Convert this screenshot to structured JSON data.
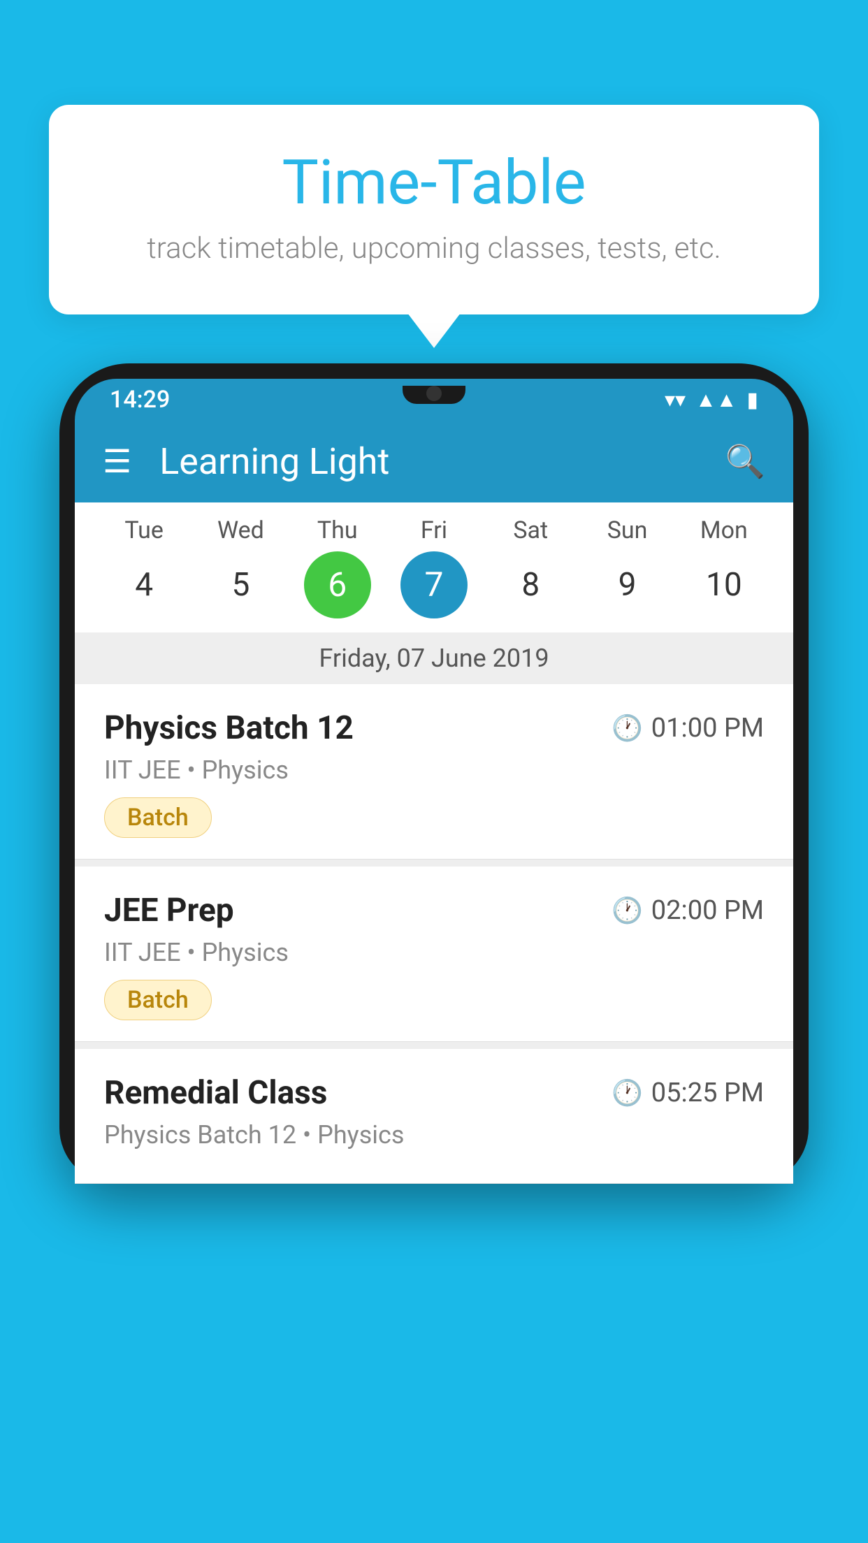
{
  "page": {
    "background_color": "#1ab9e8"
  },
  "tooltip": {
    "title": "Time-Table",
    "subtitle": "track timetable, upcoming classes, tests, etc."
  },
  "phone": {
    "status_bar": {
      "time": "14:29"
    },
    "toolbar": {
      "app_name": "Learning Light"
    },
    "calendar": {
      "days": [
        {
          "day": "Tue",
          "number": "4"
        },
        {
          "day": "Wed",
          "number": "5"
        },
        {
          "day": "Thu",
          "number": "6",
          "type": "today"
        },
        {
          "day": "Fri",
          "number": "7",
          "type": "selected"
        },
        {
          "day": "Sat",
          "number": "8"
        },
        {
          "day": "Sun",
          "number": "9"
        },
        {
          "day": "Mon",
          "number": "10"
        }
      ],
      "selected_date_label": "Friday, 07 June 2019"
    },
    "classes": [
      {
        "name": "Physics Batch 12",
        "time": "01:00 PM",
        "meta": "IIT JEE • Physics",
        "badge": "Batch"
      },
      {
        "name": "JEE Prep",
        "time": "02:00 PM",
        "meta": "IIT JEE • Physics",
        "badge": "Batch"
      },
      {
        "name": "Remedial Class",
        "time": "05:25 PM",
        "meta": "Physics Batch 12 • Physics",
        "badge": ""
      }
    ]
  }
}
